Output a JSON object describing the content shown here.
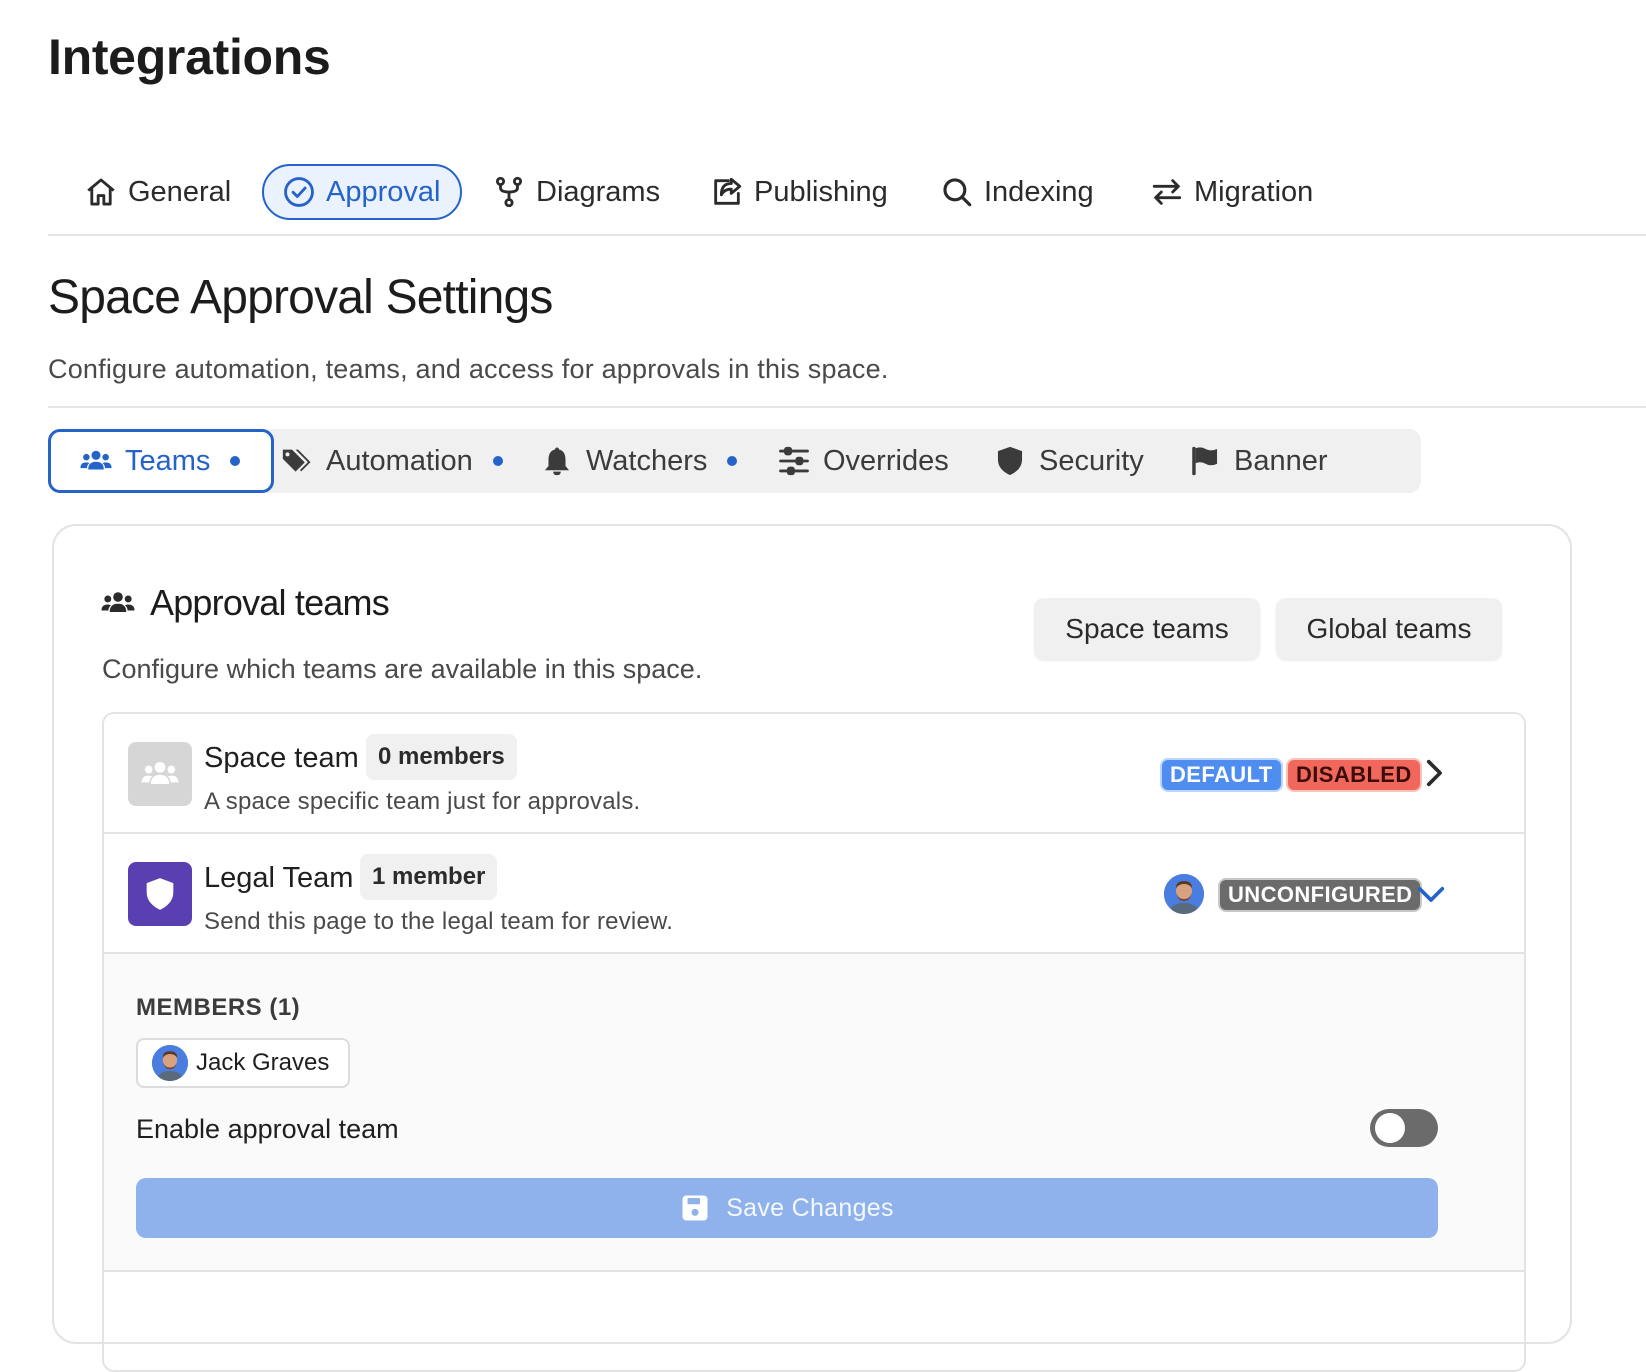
{
  "header": {
    "title": "Integrations"
  },
  "nav": {
    "items": [
      {
        "label": "General",
        "icon": "home-icon"
      },
      {
        "label": "Approval",
        "icon": "check-circle-icon",
        "active": true
      },
      {
        "label": "Diagrams",
        "icon": "fork-icon"
      },
      {
        "label": "Publishing",
        "icon": "share-icon"
      },
      {
        "label": "Indexing",
        "icon": "search-icon"
      },
      {
        "label": "Migration",
        "icon": "arrows-exchange-icon"
      }
    ]
  },
  "section": {
    "title": "Space Approval Settings",
    "description": "Configure automation, teams, and access for approvals in this space."
  },
  "tabs": {
    "items": [
      {
        "label": "Teams",
        "icon": "users-icon",
        "active": true,
        "dot": true
      },
      {
        "label": "Automation",
        "icon": "tags-icon",
        "dot": true
      },
      {
        "label": "Watchers",
        "icon": "bell-icon",
        "dot": true
      },
      {
        "label": "Overrides",
        "icon": "sliders-icon"
      },
      {
        "label": "Security",
        "icon": "shield-icon"
      },
      {
        "label": "Banner",
        "icon": "flag-icon"
      }
    ]
  },
  "card": {
    "title": "Approval teams",
    "description": "Configure which teams are available in this space.",
    "space_teams_label": "Space teams",
    "global_teams_label": "Global teams"
  },
  "teams": [
    {
      "name": "Space team",
      "members": "0 members",
      "description": "A space specific team just for approvals.",
      "badges": [
        "DEFAULT",
        "DISABLED"
      ]
    },
    {
      "name": "Legal Team",
      "members": "1 member",
      "description": "Send this page to the legal team for review.",
      "badges": [
        "UNCONFIGURED"
      ]
    }
  ],
  "expanded": {
    "members_label": "MEMBERS (1)",
    "member_name": "Jack Graves",
    "enable_label": "Enable approval team",
    "enabled": false,
    "save_label": "Save Changes"
  },
  "colors": {
    "accent": "#2563c9",
    "legal_team_icon_bg": "#5a3fb0",
    "space_team_icon_bg": "#d6d6d6"
  }
}
